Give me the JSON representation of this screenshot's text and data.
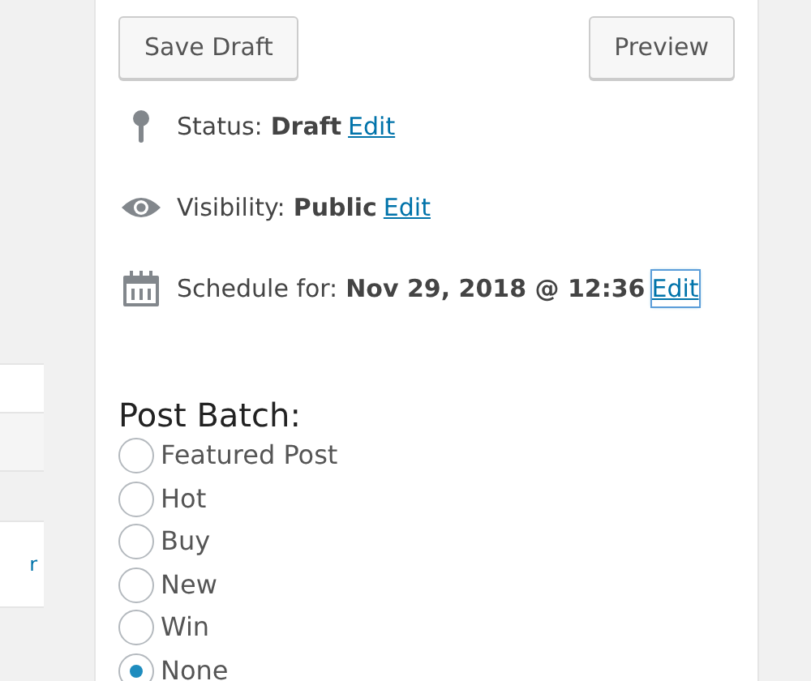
{
  "buttons": [
    {
      "label": "Save Draft"
    },
    {
      "label": "Preview"
    }
  ],
  "meta": [
    {
      "kind": "status",
      "label": "Status:",
      "value": "Draft",
      "link": "Edit",
      "focused": false
    },
    {
      "kind": "visibility",
      "label": "Visibility:",
      "value": "Public",
      "link": "Edit",
      "focused": false
    },
    {
      "kind": "schedule",
      "label": "Schedule for:",
      "value": "Nov 29, 2018 @ 12:36",
      "link": "Edit",
      "focused": true
    }
  ],
  "post_batch": {
    "title": "Post Batch:",
    "options": [
      {
        "label": "Featured Post",
        "selected": false
      },
      {
        "label": "Hot",
        "selected": false
      },
      {
        "label": "Buy",
        "selected": false
      },
      {
        "label": "New",
        "selected": false
      },
      {
        "label": "Win",
        "selected": false
      },
      {
        "label": "None",
        "selected": true
      }
    ]
  },
  "left_fragment": {
    "text": "r"
  }
}
